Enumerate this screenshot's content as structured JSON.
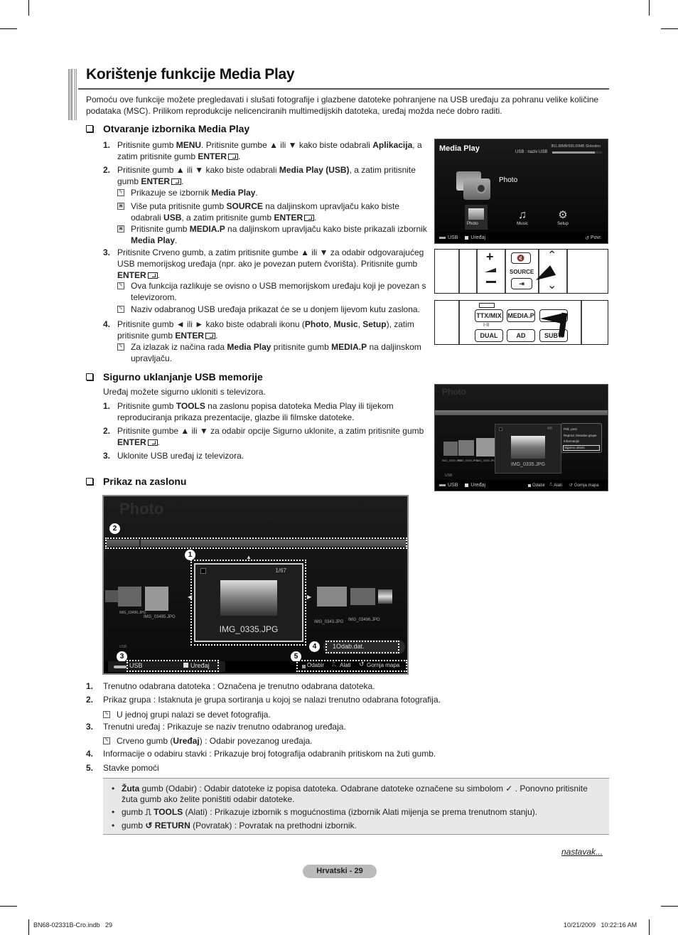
{
  "page": {
    "title": "Korištenje funkcije Media Play",
    "intro": "Pomoću ove funkcije možete pregledavati i slušati fotografije i glazbene datoteke pohranjene na USB uređaju za pohranu velike količine podataka (MSC). Prilikom reprodukcije nelicenciranih multimedijskih datoteka, uređaj možda neće dobro raditi."
  },
  "section1": {
    "heading": "Otvaranje izbornika Media Play",
    "steps": [
      {
        "num": "1.",
        "parts": [
          "Pritisnite gumb ",
          "MENU",
          ". Pritisnite gumbe ▲ ili ▼ kako biste odabrali ",
          "Aplikacija",
          ", a zatim pritisnite gumb ",
          "ENTER",
          "."
        ]
      },
      {
        "num": "2.",
        "parts": [
          "Pritisnite gumb ▲ ili ▼ kako biste odabrali ",
          "Media Play (USB)",
          ", a zatim pritisnite gumb ",
          "ENTER",
          "."
        ]
      },
      {
        "num": "3.",
        "parts": [
          "Pritisnite Crveno gumb, a zatim pritisnite gumbe ▲ ili ▼ za odabir odgovarajućeg USB memorijskog uređaja (npr. ako je povezan putem čvorišta). Pritisnite gumb ",
          "ENTER",
          "."
        ]
      },
      {
        "num": "4.",
        "parts": [
          "Pritisnite gumb ◄ ili ► kako biste odabrali ikonu (",
          "Photo",
          ", ",
          "Music",
          ", ",
          "Setup",
          "), zatim pritisnite gumb ",
          "ENTER",
          "."
        ]
      }
    ],
    "notes": [
      {
        "icon": "note-icon",
        "parts": [
          "Prikazuje se izbornik ",
          "Media Play",
          "."
        ]
      },
      {
        "icon": "remote-icon",
        "parts": [
          "Više puta pritisnite gumb ",
          "SOURCE",
          " na daljinskom upravljaču kako biste odabrali ",
          "USB",
          ", a zatim pritisnite gumb ",
          "ENTER",
          "."
        ]
      },
      {
        "icon": "remote-icon",
        "parts": [
          "Pritisnite gumb ",
          "MEDIA.P",
          " na daljinskom upravljaču kako biste prikazali izbornik ",
          "Media Play",
          "."
        ]
      },
      {
        "icon": "note-icon",
        "parts": [
          "Ova funkcija razlikuje se ovisno o USB memorijskom uređaju koji je povezan s televizorom."
        ]
      },
      {
        "icon": "note-icon",
        "parts": [
          "Naziv odabranog USB uređaja prikazat će se u donjem lijevom kutu zaslona."
        ]
      },
      {
        "icon": "note-icon",
        "parts": [
          "Za izlazak iz načina rada ",
          "Media Play",
          " pritisnite gumb ",
          "MEDIA.P",
          " na daljinskom upravljaču."
        ]
      }
    ]
  },
  "section2": {
    "heading": "Sigurno uklanjanje USB memorije",
    "intro": "Uređaj možete sigurno ukloniti s televizora.",
    "steps": [
      {
        "num": "1.",
        "parts": [
          "Pritisnite gumb ",
          "TOOLS",
          " na zaslonu popisa datoteka Media Play ili tijekom reproduciranja prikaza prezentacije, glazbe ili filmske datoteke."
        ]
      },
      {
        "num": "2.",
        "parts": [
          "Pritisnite gumbe ▲ ili ▼ za odabir opcije Sigurno uklonite, a zatim pritisnite gumb ",
          "ENTER",
          "."
        ]
      },
      {
        "num": "3.",
        "parts": [
          "Uklonite USB uređaj iz televizora."
        ]
      }
    ]
  },
  "section3": {
    "heading": "Prikaz na zaslonu"
  },
  "screen_media_play": {
    "title": "Media Play",
    "usb_name": "USB : naziv USB",
    "storage": "851.98MB/995.00MB Slobodno",
    "storage_used_fraction": 0.86,
    "selected_label": "Photo",
    "icons": [
      {
        "label": "Photo"
      },
      {
        "label": "Music"
      },
      {
        "label": "Setup"
      }
    ],
    "bottom_left": "USB",
    "bottom_device": "Uređaj",
    "bottom_right": "Povr."
  },
  "remote1": {
    "source_label": "SOURCE"
  },
  "remote2": {
    "buttons": [
      "TTX/MIX",
      "MEDIA.P",
      "DUAL",
      "AD",
      "SUBT."
    ],
    "dual_sub": "I-II"
  },
  "screen_tools": {
    "title": "Photo",
    "counter": "4/6",
    "filename": "IMG_0335.JPG",
    "menu": [
      "Prik. prez.",
      "Reprod. trenutne grupe",
      "Informacije",
      "Sigurno ukloni"
    ],
    "thumb_labels": [
      "IMG_0335.JPG",
      "IMG_0335.JPG",
      "IMG_0335.JPG"
    ],
    "device": "USB",
    "bottom_left": "USB",
    "bottom_device": "Uređaj",
    "help": [
      "Odabir",
      "Alati",
      "Gornja mapa"
    ]
  },
  "screen_browser": {
    "title": "Photo",
    "counter": "1/67",
    "filename": "IMG_0335.JPG",
    "left_labels": [
      "IMG_03496.JPG",
      "IMG_03495.JPG"
    ],
    "right_labels": [
      "IMG_0343.JPG",
      "IMG_03496.JPG"
    ],
    "device_small": "USB",
    "selection_info": "1Odab.dat.",
    "bottom_left": "USB",
    "bottom_device": "Uređaj",
    "help": [
      "Odabir",
      "Alati",
      "Gornja mapa"
    ],
    "callouts": [
      "1",
      "2",
      "3",
      "4",
      "5"
    ]
  },
  "legend": [
    {
      "num": "1.",
      "text": "Trenutno odabrana datoteka : Označena je trenutno odabrana datoteka."
    },
    {
      "num": "2.",
      "text": "Prikaz grupa : Istaknuta je grupa sortiranja u kojoj se nalazi trenutno odabrana fotografija."
    },
    {
      "note": "U jednoj grupi nalazi se devet fotografija."
    },
    {
      "num": "3.",
      "text": "Trenutni uređaj : Prikazuje se naziv trenutno odabranog uređaja."
    },
    {
      "note_parts": [
        "Crveno gumb (",
        "Uređaj",
        ") : Odabir povezanog uređaja."
      ]
    },
    {
      "num": "4.",
      "text": "Informacije o odabiru stavki : Prikazuje broj fotografija odabranih pritiskom na žuti gumb."
    },
    {
      "num": "5.",
      "text": "Stavke pomoći"
    }
  ],
  "help_bullets": [
    {
      "parts": [
        "Žuta",
        " gumb (Odabir) : Odabir datoteke iz popisa datoteka. Odabrane datoteke označene su simbolom ✓ . Ponovno pritisnite žuta gumb ako želite poništiti odabir datoteke."
      ]
    },
    {
      "parts": [
        "gumb ",
        "TOOLS",
        " (Alati) : Prikazuje izbornik s mogućnostima (izbornik Alati mijenja se prema trenutnom stanju)."
      ]
    },
    {
      "parts": [
        "gumb ",
        "RETURN",
        " (Povratak) : Povratak na prethodni izbornik."
      ]
    }
  ],
  "footer": {
    "continue": "nastavak...",
    "page_label": "Hrvatski - 29",
    "file": "BN68-02331B-Cro.indb   29",
    "timestamp": "10/21/2009   10:22:16 AM"
  }
}
